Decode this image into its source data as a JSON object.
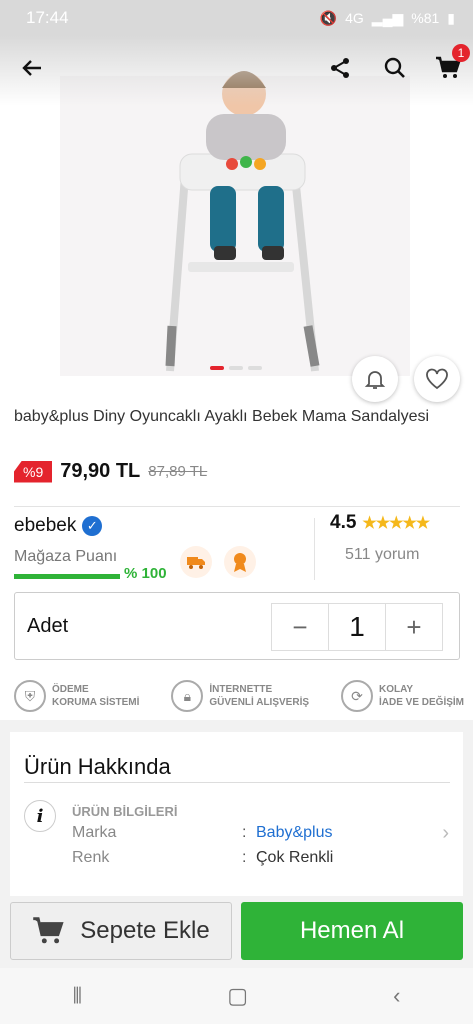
{
  "status_bar": {
    "time": "17:44",
    "battery": "%81",
    "signal": "4G"
  },
  "header": {
    "cart_count": "1"
  },
  "product": {
    "title": "baby&plus Diny Oyuncaklı Ayaklı Bebek Mama Sandalyesi",
    "discount": "%9",
    "price": "79,90 TL",
    "old_price": "87,89 TL",
    "image_pages": 3,
    "active_image": 1
  },
  "seller": {
    "name": "ebebek",
    "score_label": "Mağaza Puanı",
    "score_value": "% 100",
    "score_fraction": 1.0,
    "rating": "4.5",
    "stars": "★★★★★",
    "reviews": "511 yorum"
  },
  "quantity": {
    "label": "Adet",
    "value": "1",
    "minus": "−",
    "plus": "+"
  },
  "trust": [
    {
      "line1": "ÖDEME",
      "line2": "KORUMA SİSTEMİ",
      "icon": "shield-icon"
    },
    {
      "line1": "İNTERNETTE",
      "line2": "GÜVENLİ ALIŞVERİŞ",
      "icon": "lock-icon"
    },
    {
      "line1": "KOLAY",
      "line2": "İADE VE DEĞİŞİM",
      "icon": "refresh-icon"
    }
  ],
  "about": {
    "title": "Ürün Hakkında",
    "info_header": "ÜRÜN BİLGİLERİ",
    "rows": [
      {
        "key": "Marka",
        "value": "Baby&plus"
      },
      {
        "key": "Renk",
        "value": "Çok Renkli"
      }
    ]
  },
  "actions": {
    "add_to_cart": "Sepete Ekle",
    "buy_now": "Hemen Al"
  },
  "colors": {
    "accent_red": "#e4242d",
    "green": "#2fb338",
    "link_blue": "#1f6fd1"
  }
}
